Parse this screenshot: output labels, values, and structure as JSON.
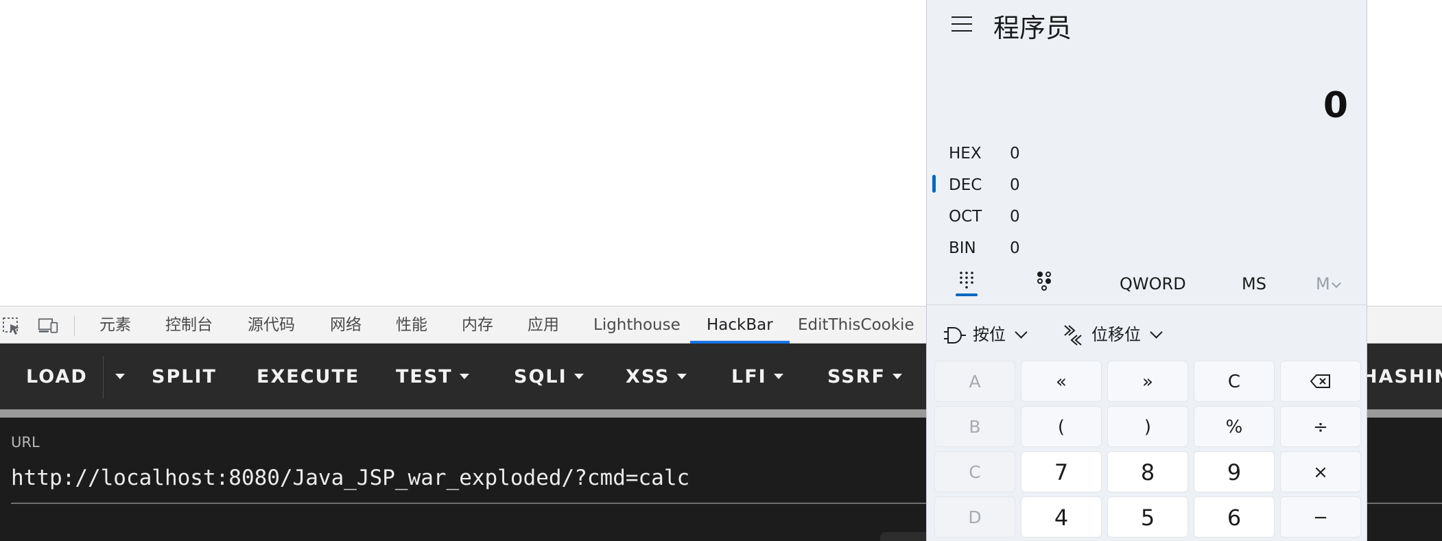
{
  "devtools": {
    "tabs": [
      {
        "label": "元素"
      },
      {
        "label": "控制台"
      },
      {
        "label": "源代码"
      },
      {
        "label": "网络"
      },
      {
        "label": "性能"
      },
      {
        "label": "内存"
      },
      {
        "label": "应用"
      },
      {
        "label": "Lighthouse"
      },
      {
        "label": "HackBar",
        "active": true
      },
      {
        "label": "EditThisCookie"
      }
    ],
    "accent_color": "#1a73e8"
  },
  "hackbar": {
    "buttons": {
      "load": "LOAD",
      "split": "SPLIT",
      "execute": "EXECUTE",
      "test": "TEST",
      "sqli": "SQLI",
      "xss": "XSS",
      "lfi": "LFI",
      "ssrf": "SSRF",
      "hashing": "HASHIN"
    },
    "url_label": "URL",
    "url_value": "http://localhost:8080/Java_JSP_war_exploded/?cmd=calc"
  },
  "calculator": {
    "title": "程序员",
    "display": "0",
    "radix": {
      "hex": {
        "label": "HEX",
        "value": "0"
      },
      "dec": {
        "label": "DEC",
        "value": "0"
      },
      "oct": {
        "label": "OCT",
        "value": "0"
      },
      "bin": {
        "label": "BIN",
        "value": "0"
      }
    },
    "active_radix": "DEC",
    "word_size": "QWORD",
    "memory_store": "MS",
    "memory_menu": "M",
    "bitwise_label": "按位",
    "bitshift_label": "位移位",
    "keys": {
      "A": "A",
      "lsh": "«",
      "rsh": "»",
      "clear": "C",
      "B": "B",
      "lparen": "(",
      "rparen": ")",
      "mod": "%",
      "div": "÷",
      "C": "C",
      "seven": "7",
      "eight": "8",
      "nine": "9",
      "mul": "×",
      "D": "D",
      "four": "4",
      "five": "5",
      "six": "6",
      "minus": "−"
    },
    "accent_color": "#0067c0"
  }
}
